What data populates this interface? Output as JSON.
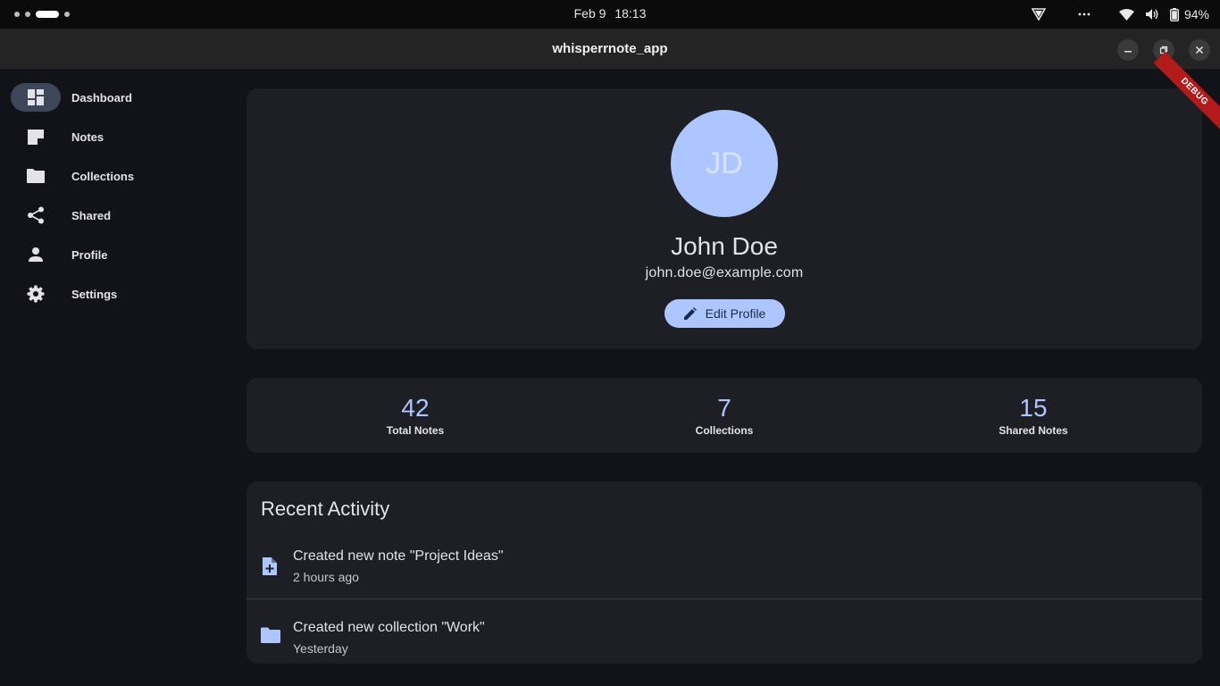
{
  "system": {
    "date": "Feb 9",
    "time": "18:13",
    "battery": "94%"
  },
  "window": {
    "title": "whisperrnote_app"
  },
  "sidebar": {
    "items": [
      {
        "label": "Dashboard",
        "icon": "dashboard-icon",
        "active": true
      },
      {
        "label": "Notes",
        "icon": "note-icon"
      },
      {
        "label": "Collections",
        "icon": "folder-icon"
      },
      {
        "label": "Shared",
        "icon": "share-icon"
      },
      {
        "label": "Profile",
        "icon": "person-icon"
      },
      {
        "label": "Settings",
        "icon": "gear-icon"
      }
    ]
  },
  "profile": {
    "initials": "JD",
    "name": "John Doe",
    "email": "john.doe@example.com",
    "edit_label": "Edit Profile"
  },
  "stats": [
    {
      "value": "42",
      "label": "Total Notes"
    },
    {
      "value": "7",
      "label": "Collections"
    },
    {
      "value": "15",
      "label": "Shared Notes"
    }
  ],
  "activity": {
    "title": "Recent Activity",
    "items": [
      {
        "text": "Created new note \"Project Ideas\"",
        "time": "2 hours ago",
        "icon": "note-add-icon"
      },
      {
        "text": "Created new collection \"Work\"",
        "time": "Yesterday",
        "icon": "folder-icon"
      }
    ]
  },
  "debug_label": "DEBUG",
  "colors": {
    "accent": "#adc6ff",
    "background": "#121318",
    "card": "#1e1f25",
    "nav_active": "#3e4759",
    "debug": "#b31b1b"
  }
}
